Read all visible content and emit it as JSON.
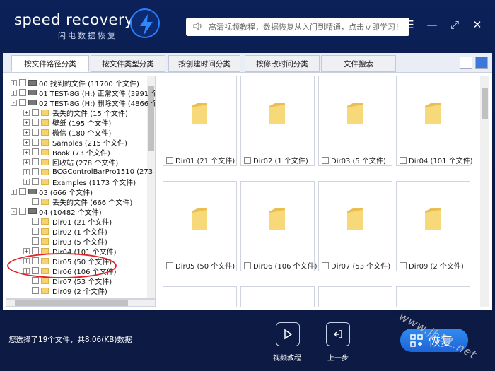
{
  "app": {
    "brand": "speed recovery",
    "brand_sub": "闪电数据恢复"
  },
  "header": {
    "notice": "高清视频教程，数据恢复从入门到精通，点击立即学习！"
  },
  "tabs": [
    "按文件路径分类",
    "按文件类型分类",
    "按创建时间分类",
    "按修改时间分类",
    "文件搜索"
  ],
  "tree": [
    {
      "level": 0,
      "exp": "+",
      "icon": "drive",
      "label": "00 找到的文件 (11700 个文件)"
    },
    {
      "level": 0,
      "exp": "+",
      "icon": "drive",
      "label": "01 TEST-8G (H:) 正常文件 (3991 个"
    },
    {
      "level": 0,
      "exp": "-",
      "icon": "drive",
      "label": "02 TEST-8G (H:) 删除文件 (4866 个"
    },
    {
      "level": 1,
      "exp": "+",
      "icon": "folder",
      "label": "丢失的文件    (15 个文件)"
    },
    {
      "level": 1,
      "exp": "+",
      "icon": "folder",
      "label": "壁纸    (195 个文件)"
    },
    {
      "level": 1,
      "exp": "+",
      "icon": "folder",
      "label": "微信    (180 个文件)"
    },
    {
      "level": 1,
      "exp": "+",
      "icon": "folder",
      "label": "Samples    (215 个文件)"
    },
    {
      "level": 1,
      "exp": "+",
      "icon": "folder",
      "label": "Book    (73 个文件)"
    },
    {
      "level": 1,
      "exp": "+",
      "icon": "folder",
      "label": "回收站    (278 个文件)"
    },
    {
      "level": 1,
      "exp": "+",
      "icon": "folder",
      "label": "BCGControlBarPro1510    (273"
    },
    {
      "level": 1,
      "exp": "+",
      "icon": "folder",
      "label": "Examples    (1173 个文件)"
    },
    {
      "level": 0,
      "exp": "+",
      "icon": "drive",
      "label": "03    (666 个文件)"
    },
    {
      "level": 1,
      "exp": "",
      "icon": "folder",
      "label": "丢失的文件    (666 个文件)"
    },
    {
      "level": 0,
      "exp": "-",
      "icon": "drive",
      "label": "04    (10482 个文件)"
    },
    {
      "level": 1,
      "exp": "",
      "icon": "folder",
      "label": "Dir01    (21 个文件)"
    },
    {
      "level": 1,
      "exp": "",
      "icon": "folder",
      "label": "Dir02    (1 个文件)"
    },
    {
      "level": 1,
      "exp": "",
      "icon": "folder",
      "label": "Dir03    (5 个文件)"
    },
    {
      "level": 1,
      "exp": "+",
      "icon": "folder",
      "label": "Dir04    (101 个文件)"
    },
    {
      "level": 1,
      "exp": "+",
      "icon": "folder",
      "label": "Dir05    (50 个文件)"
    },
    {
      "level": 1,
      "exp": "+",
      "icon": "folder",
      "label": "Dir06    (106 个文件)"
    },
    {
      "level": 1,
      "exp": "",
      "icon": "folder",
      "label": "Dir07    (53 个文件)"
    },
    {
      "level": 1,
      "exp": "",
      "icon": "folder",
      "label": "Dir09    (2 个文件)"
    }
  ],
  "cards": [
    "Dir01 (21 个文件)",
    "Dir02 (1 个文件)",
    "Dir03 (5 个文件)",
    "Dir04 (101 个文件)",
    "Dir05 (50 个文件)",
    "Dir06 (106 个文件)",
    "Dir07 (53 个文件)",
    "Dir09 (2 个文件)",
    "",
    "",
    "",
    ""
  ],
  "footer": {
    "status": "您选择了19个文件，共8.06(KB)数据",
    "video_label": "视频教程",
    "back_label": "上一步",
    "recover_label": "恢复"
  },
  "watermark": "www.jb51.net",
  "colors": {
    "accent": "#1f64d8",
    "highlight_ring": "#e0262c",
    "folder": "#f6d36e"
  }
}
